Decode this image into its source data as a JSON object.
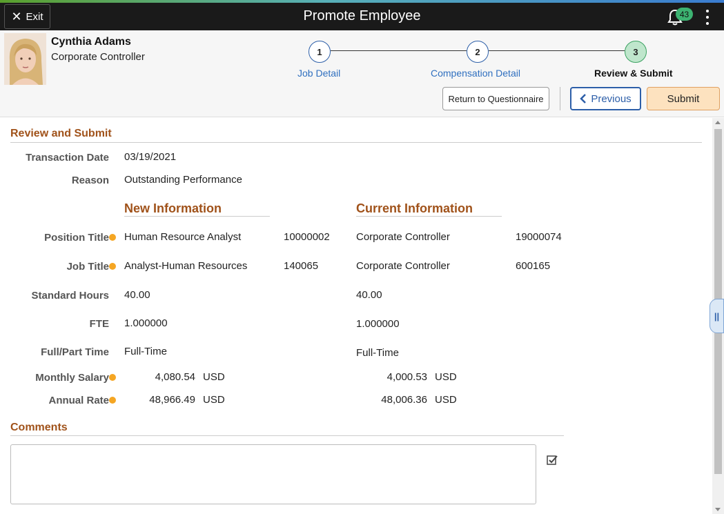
{
  "banner": {
    "exit_label": "Exit",
    "title": "Promote Employee",
    "notification_count": "43"
  },
  "employee": {
    "name": "Cynthia Adams",
    "title": "Corporate Controller"
  },
  "train": {
    "steps": [
      {
        "number": "1",
        "label": "Job Detail",
        "state": "link"
      },
      {
        "number": "2",
        "label": "Compensation Detail",
        "state": "link"
      },
      {
        "number": "3",
        "label": "Review & Submit",
        "state": "active"
      }
    ]
  },
  "actions": {
    "return_label": "Return to Questionnaire",
    "previous_label": "Previous",
    "submit_label": "Submit"
  },
  "review": {
    "section_title": "Review and Submit",
    "transaction_date_label": "Transaction Date",
    "transaction_date": "03/19/2021",
    "reason_label": "Reason",
    "reason": "Outstanding Performance",
    "new_heading": "New Information",
    "current_heading": "Current Information",
    "rows": {
      "position": {
        "label": "Position Title",
        "new": "Human Resource Analyst",
        "new_code": "10000002",
        "current": "Corporate Controller",
        "current_code": "19000074"
      },
      "job": {
        "label": "Job Title",
        "new": "Analyst-Human Resources",
        "new_code": "140065",
        "current": "Corporate Controller",
        "current_code": "600165"
      },
      "hours": {
        "label": "Standard Hours",
        "new": "40.00",
        "current": "40.00"
      },
      "fte": {
        "label": "FTE",
        "new": "1.000000",
        "current": "1.000000"
      },
      "fullpart": {
        "label": "Full/Part Time",
        "new": "Full-Time",
        "current": "Full-Time"
      },
      "monthly": {
        "label": "Monthly Salary",
        "new": "4,080.54",
        "current": "4,000.53",
        "currency": "USD"
      },
      "annual": {
        "label": "Annual Rate",
        "new": "48,966.49",
        "current": "48,006.36",
        "currency": "USD"
      }
    }
  },
  "comments": {
    "section_title": "Comments",
    "value": ""
  },
  "colors": {
    "accent": "#a0521a",
    "link": "#2f6fbf",
    "required_dot": "#f5a623",
    "submit_bg": "#fde2bf",
    "badge": "#3cb371"
  }
}
